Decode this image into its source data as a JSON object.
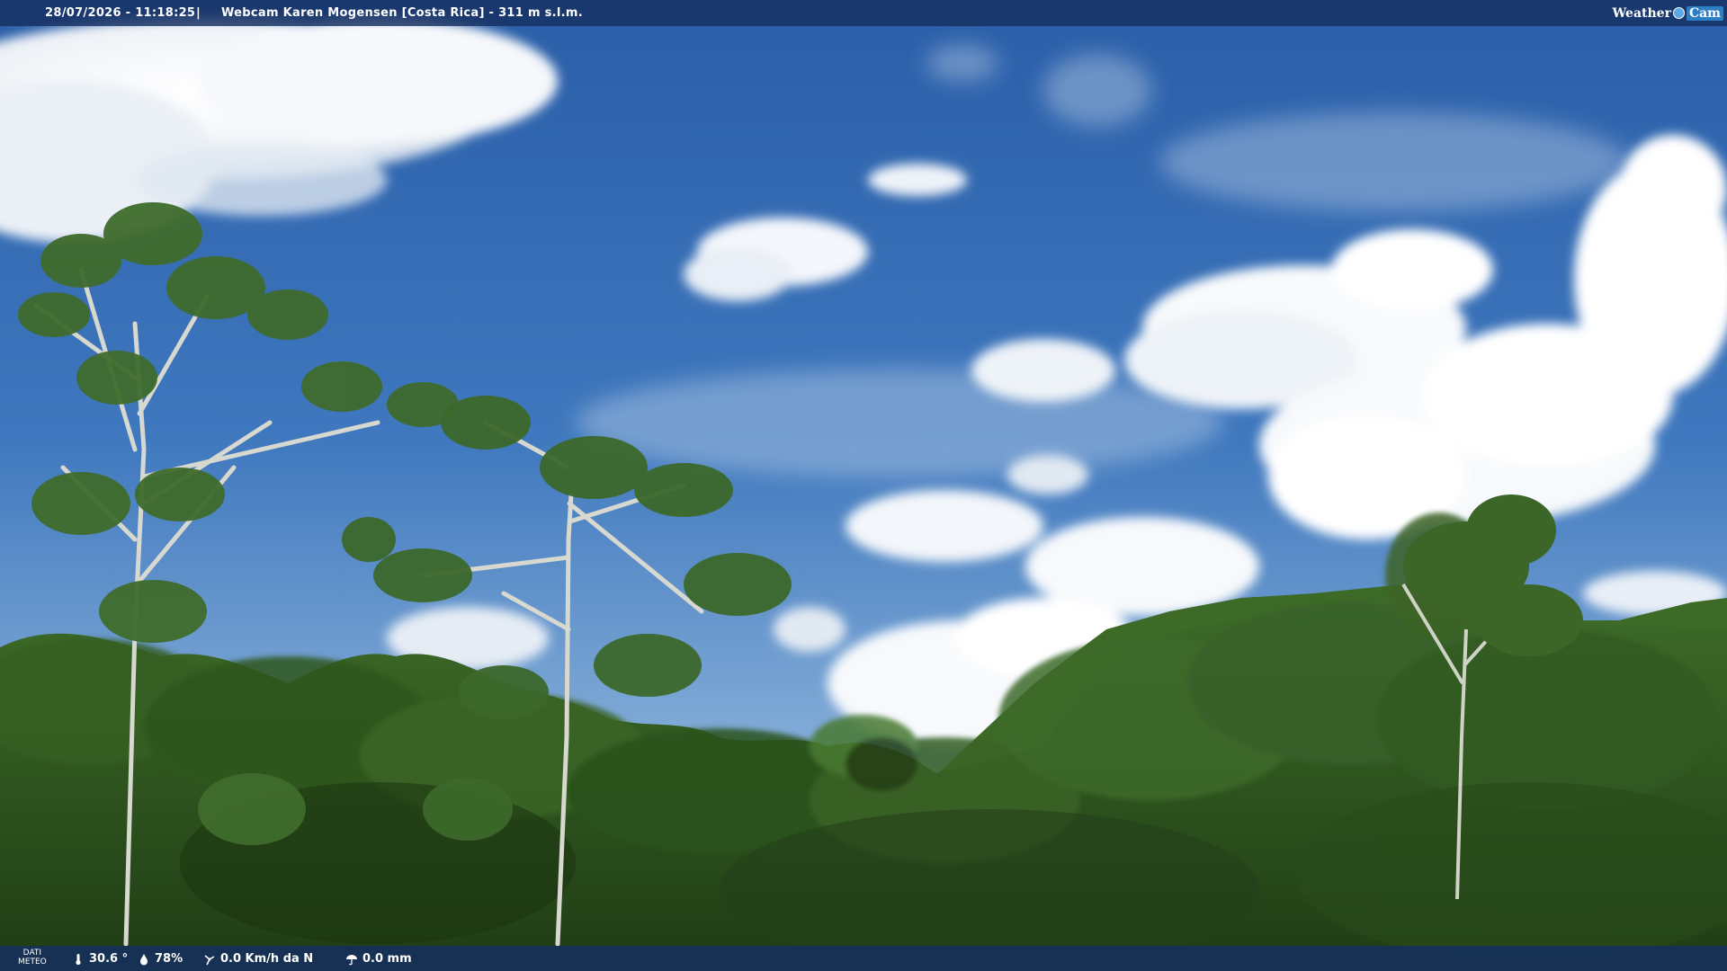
{
  "overlay": {
    "datetime": "28/07/2026 - 11:18:25",
    "separator": "|",
    "title": "Webcam Karen Mogensen [Costa Rica]  - 311 m s.l.m."
  },
  "logo": {
    "part1": "Weather",
    "part2": "Cam"
  },
  "meteo": {
    "label_line1": "DATI",
    "label_line2": "METEO",
    "temperature": "30.6 °",
    "humidity": "78%",
    "wind": "0.0 Km/h da N",
    "rain": "0.0 mm"
  },
  "icons": {
    "temperature": "thermometer-icon",
    "humidity": "drop-icon",
    "wind": "wind-icon",
    "rain": "rain-icon"
  },
  "colors": {
    "bar_background": "#16305f",
    "sky_top": "#2c5fa8",
    "sky_bottom": "#8fb7dc",
    "forest": "#2f5a1e"
  }
}
